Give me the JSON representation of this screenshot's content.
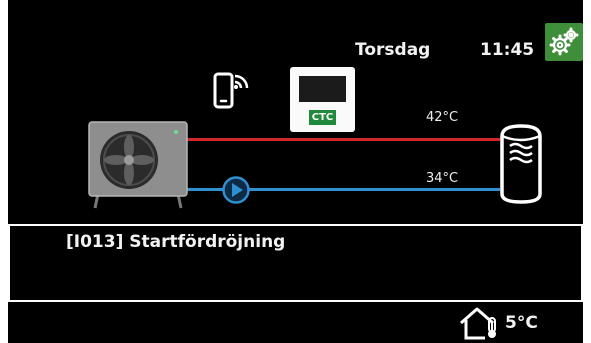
{
  "header": {
    "day": "Torsdag",
    "time": "11:45"
  },
  "icons": {
    "settings": "gears-icon",
    "remote": "smartphone-wifi-icon",
    "controller": "indoor-unit-icon",
    "heat_pump": "heat-pump-icon",
    "pump": "circulation-pump-icon",
    "tank": "water-tank-icon",
    "outdoor": "house-thermometer-icon"
  },
  "controller": {
    "logo": "CTC"
  },
  "circuit": {
    "supply_temp": "42°C",
    "return_temp": "34°C"
  },
  "info": {
    "message": "[I013] Startfördröjning"
  },
  "footer": {
    "outdoor_temp": "5°C"
  },
  "colors": {
    "background": "#000000",
    "supply_pipe": "#d0282b",
    "return_pipe": "#2f8fd1",
    "settings_button": "#3f8f3a",
    "text": "#f2f2f2"
  }
}
